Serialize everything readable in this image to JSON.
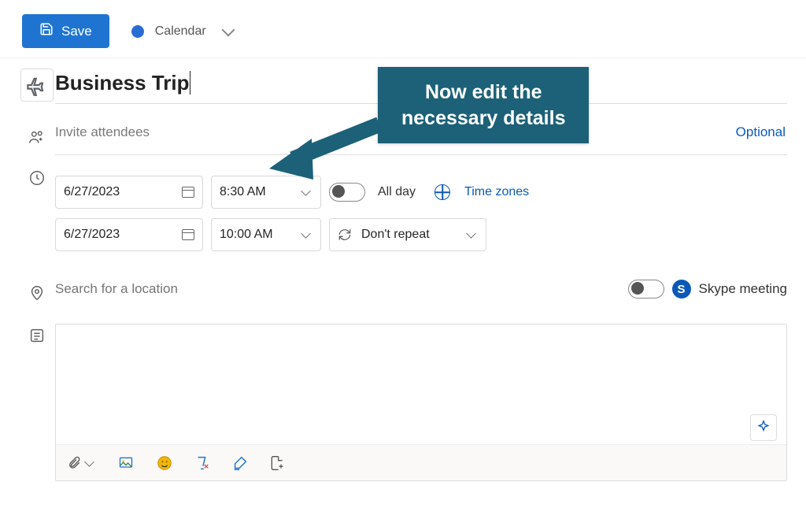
{
  "toolbar": {
    "save_label": "Save",
    "calendar_label": "Calendar"
  },
  "event": {
    "title": "Business Trip",
    "attendees_placeholder": "Invite attendees",
    "optional_label": "Optional",
    "start_date": "6/27/2023",
    "start_time": "8:30 AM",
    "end_date": "6/27/2023",
    "end_time": "10:00 AM",
    "all_day_label": "All day",
    "time_zones_label": "Time zones",
    "repeat_label": "Don't repeat",
    "location_placeholder": "Search for a location",
    "skype_label": "Skype meeting"
  },
  "callout": {
    "line1": "Now edit the",
    "line2": "necessary details"
  }
}
